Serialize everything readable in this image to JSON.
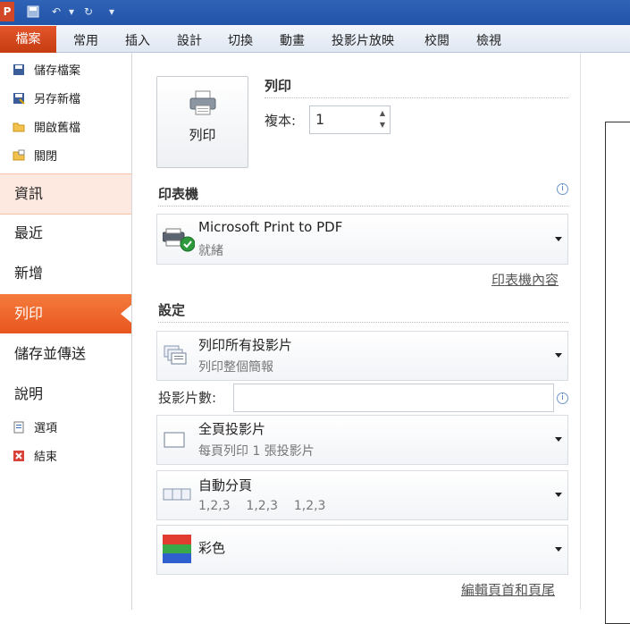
{
  "app": {
    "logo_letter": "P"
  },
  "ribbon": {
    "file_tab": "檔案",
    "tabs": [
      "常用",
      "插入",
      "設計",
      "切換",
      "動畫",
      "投影片放映",
      "校閱",
      "檢視"
    ]
  },
  "nav": {
    "save": "儲存檔案",
    "save_as": "另存新檔",
    "open": "開啟舊檔",
    "close": "關閉",
    "info": "資訊",
    "recent": "最近",
    "new": "新增",
    "print": "列印",
    "save_send": "儲存並傳送",
    "help": "說明",
    "options": "選項",
    "exit": "結束"
  },
  "print": {
    "section_title": "列印",
    "button_label": "列印",
    "copies_label": "複本:",
    "copies_value": "1"
  },
  "printer": {
    "section_title": "印表機",
    "name": "Microsoft Print to PDF",
    "status": "就緒",
    "properties_link": "印表機內容"
  },
  "settings": {
    "section_title": "設定",
    "range_title": "列印所有投影片",
    "range_sub": "列印整個簡報",
    "slides_label": "投影片數:",
    "slides_value": "",
    "layout_title": "全頁投影片",
    "layout_sub": "每頁列印 1 張投影片",
    "collate_title": "自動分頁",
    "collate_sub": "1,2,3    1,2,3    1,2,3",
    "color_title": "彩色",
    "header_footer_link": "編輯頁首和頁尾"
  }
}
